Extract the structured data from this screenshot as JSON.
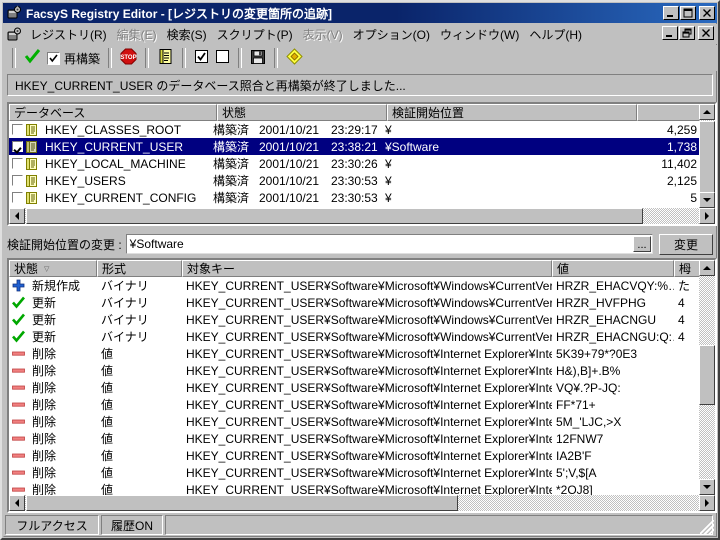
{
  "window": {
    "title": "FacsyS Registry Editor - [レジストリの変更箇所の追跡]",
    "app_icon": "registry-app-icon",
    "minimize": "_",
    "maximize": "□",
    "close": "✕",
    "mdi_minimize": "_",
    "mdi_restore": "❐",
    "mdi_close": "✕"
  },
  "menu": {
    "items": [
      {
        "label": "レジストリ(R)",
        "disabled": false
      },
      {
        "label": "編集(E)",
        "disabled": true
      },
      {
        "label": "検索(S)",
        "disabled": false
      },
      {
        "label": "スクリプト(P)",
        "disabled": false
      },
      {
        "label": "表示(V)",
        "disabled": true
      },
      {
        "label": "オプション(O)",
        "disabled": false
      },
      {
        "label": "ウィンドウ(W)",
        "disabled": false
      },
      {
        "label": "ヘルプ(H)",
        "disabled": false
      }
    ]
  },
  "toolbar": {
    "check_icon": "green-check-icon",
    "rebuild_checkbox_checked": true,
    "rebuild_label": "再構築",
    "stop_icon": "stop-sign-icon",
    "script_icon": "note-document-icon",
    "checkall_icon": "checkbox-checked-icon",
    "uncheckall_icon": "checkbox-empty-icon",
    "save_icon": "floppy-disk-icon",
    "diamond_icon": "yellow-diamond-icon"
  },
  "status_message": "HKEY_CURRENT_USER のデータベース照合と再構築が終了しました...",
  "database_list": {
    "columns": [
      "データベース",
      "状態",
      "検証開始位置",
      ""
    ],
    "rows": [
      {
        "checked": false,
        "icon": "database-icon",
        "name": "HKEY_CLASSES_ROOT",
        "state": "構築済",
        "date": "2001/10/21",
        "time": "23:29:17",
        "path": "¥",
        "count": "4,259",
        "selected": false
      },
      {
        "checked": true,
        "icon": "database-icon",
        "name": "HKEY_CURRENT_USER",
        "state": "構築済",
        "date": "2001/10/21",
        "time": "23:38:21",
        "path": "¥Software",
        "count": "1,738",
        "selected": true
      },
      {
        "checked": false,
        "icon": "database-icon",
        "name": "HKEY_LOCAL_MACHINE",
        "state": "構築済",
        "date": "2001/10/21",
        "time": "23:30:26",
        "path": "¥",
        "count": "11,402",
        "selected": false
      },
      {
        "checked": false,
        "icon": "database-icon",
        "name": "HKEY_USERS",
        "state": "構築済",
        "date": "2001/10/21",
        "time": "23:30:53",
        "path": "¥",
        "count": "2,125",
        "selected": false
      },
      {
        "checked": false,
        "icon": "database-icon",
        "name": "HKEY_CURRENT_CONFIG",
        "state": "構築済",
        "date": "2001/10/21",
        "time": "23:30:53",
        "path": "¥",
        "count": "5",
        "selected": false
      }
    ]
  },
  "path_bar": {
    "label": "検証開始位置の変更 :",
    "value": "¥Software",
    "browse_label": "...",
    "change_button": "変更"
  },
  "change_list": {
    "columns": [
      "状態",
      "形式",
      "対象キー",
      "値",
      "栂"
    ],
    "sorted_column": 0,
    "sort_arrow": "▽",
    "rows": [
      {
        "icon": "plus-new-icon",
        "state": "新規作成",
        "type": "バイナリ",
        "key": "HKEY_CURRENT_USER¥Software¥Microsoft¥Windows¥CurrentVersion¥Ex…",
        "value": "HRZR_EHACVQY:%…",
        "extra": "た"
      },
      {
        "icon": "check-update-icon",
        "state": "更新",
        "type": "バイナリ",
        "key": "HKEY_CURRENT_USER¥Software¥Microsoft¥Windows¥CurrentVersion¥Ex…",
        "value": "HRZR_HVFPHG",
        "extra": "4"
      },
      {
        "icon": "check-update-icon",
        "state": "更新",
        "type": "バイナリ",
        "key": "HKEY_CURRENT_USER¥Software¥Microsoft¥Windows¥CurrentVersion¥Ex…",
        "value": "HRZR_EHACNGU",
        "extra": "4"
      },
      {
        "icon": "check-update-icon",
        "state": "更新",
        "type": "バイナリ",
        "key": "HKEY_CURRENT_USER¥Software¥Microsoft¥Windows¥CurrentVersion¥Ex…",
        "value": "HRZR_EHACNGU:Q:…",
        "extra": "4"
      },
      {
        "icon": "minus-delete-icon",
        "state": "削除",
        "type": "値",
        "key": "HKEY_CURRENT_USER¥Software¥Microsoft¥Internet Explorer¥IntelliForm…",
        "value": "5K39+79*?0E3",
        "extra": ""
      },
      {
        "icon": "minus-delete-icon",
        "state": "削除",
        "type": "値",
        "key": "HKEY_CURRENT_USER¥Software¥Microsoft¥Internet Explorer¥IntelliForm…",
        "value": "H&),B]+.B%",
        "extra": ""
      },
      {
        "icon": "minus-delete-icon",
        "state": "削除",
        "type": "値",
        "key": "HKEY_CURRENT_USER¥Software¥Microsoft¥Internet Explorer¥IntelliForm…",
        "value": "VQ¥.?P-JQ:",
        "extra": ""
      },
      {
        "icon": "minus-delete-icon",
        "state": "削除",
        "type": "値",
        "key": "HKEY_CURRENT_USER¥Software¥Microsoft¥Internet Explorer¥IntelliForm…",
        "value": "FF*71+",
        "extra": ""
      },
      {
        "icon": "minus-delete-icon",
        "state": "削除",
        "type": "値",
        "key": "HKEY_CURRENT_USER¥Software¥Microsoft¥Internet Explorer¥IntelliForm…",
        "value": "5M_'LJC,>X",
        "extra": ""
      },
      {
        "icon": "minus-delete-icon",
        "state": "削除",
        "type": "値",
        "key": "HKEY_CURRENT_USER¥Software¥Microsoft¥Internet Explorer¥IntelliForm…",
        "value": "12FNW7",
        "extra": ""
      },
      {
        "icon": "minus-delete-icon",
        "state": "削除",
        "type": "値",
        "key": "HKEY_CURRENT_USER¥Software¥Microsoft¥Internet Explorer¥IntelliForm…",
        "value": " IA2B'F",
        "extra": ""
      },
      {
        "icon": "minus-delete-icon",
        "state": "削除",
        "type": "値",
        "key": "HKEY_CURRENT_USER¥Software¥Microsoft¥Internet Explorer¥IntelliForm…",
        "value": "5';V,$[A",
        "extra": ""
      },
      {
        "icon": "minus-delete-icon",
        "state": "削除",
        "type": "値",
        "key": "HKEY_CURRENT_USER¥Software¥Microsoft¥Internet Explorer¥IntelliForm…",
        "value": "*2OJ8]",
        "extra": ""
      }
    ]
  },
  "status_bar": {
    "panels": [
      "フルアクセス",
      "履歴ON",
      ""
    ]
  },
  "colors": {
    "selection": "#000080",
    "face": "#c0c0c0",
    "title_active": "#0a246a",
    "new_icon": "#2060d0",
    "update_icon": "#00a000",
    "delete_icon": "#f07070"
  }
}
